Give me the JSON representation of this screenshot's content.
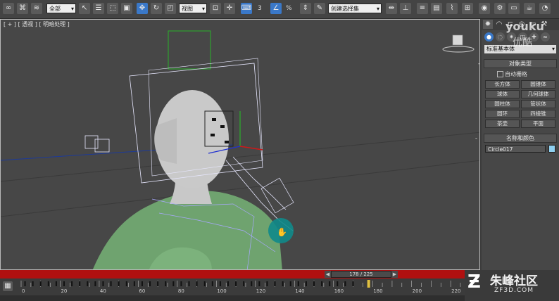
{
  "toolbar": {
    "selection_filter": "全部",
    "ref_coord": "视图",
    "snap_label": "3",
    "angle_snap_label": "%",
    "named_selection_placeholder": "创建选择集"
  },
  "viewport": {
    "label": "[ + ] [ 透视 ] [ 明暗处理 ]"
  },
  "panel": {
    "object_category": "标准基本体",
    "object_type_title": "对象类型",
    "auto_grid_label": "自动栅格",
    "object_buttons": [
      "长方体",
      "圆锥体",
      "球体",
      "几何球体",
      "圆柱体",
      "管状体",
      "圆环",
      "四棱锥",
      "茶壶",
      "平面"
    ],
    "name_color_title": "名称和颜色",
    "object_name": "Circle017",
    "object_color": "#8fd0f0"
  },
  "timeline": {
    "slider_text": "178 / 225",
    "current_frame": 178,
    "total_frames": 225,
    "ticks": [
      0,
      20,
      40,
      60,
      80,
      100,
      120,
      140,
      160,
      180,
      200,
      220
    ]
  },
  "watermarks": {
    "youku": "youku",
    "youku_cn": "优酷",
    "zf_title": "朱峰社区",
    "zf_url": "ZF3D.COM"
  }
}
